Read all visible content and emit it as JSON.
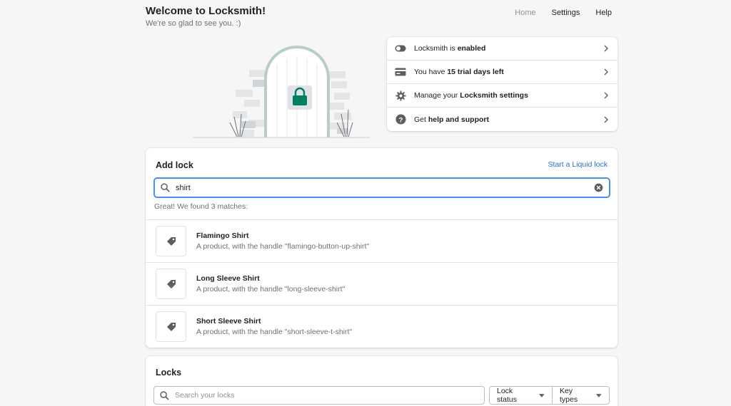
{
  "header": {
    "title": "Welcome to Locksmith!",
    "subtitle": "We're so glad to see you. :)",
    "nav": {
      "home": "Home",
      "settings": "Settings",
      "help": "Help"
    }
  },
  "status": {
    "items": [
      {
        "icon": "toggle-icon",
        "pre": "Locksmith is ",
        "bold": "enabled",
        "post": ""
      },
      {
        "icon": "credit-card-icon",
        "pre": "You have ",
        "bold": "15 trial days left",
        "post": ""
      },
      {
        "icon": "gear-icon",
        "pre": "Manage your ",
        "bold": "Locksmith settings",
        "post": ""
      },
      {
        "icon": "help-circle-icon",
        "pre": "Get ",
        "bold": "help and support",
        "post": ""
      }
    ]
  },
  "add_lock": {
    "title": "Add lock",
    "liquid_link": "Start a Liquid lock",
    "search_value": "shirt",
    "found_text": "Great! We found 3 matches:",
    "results": [
      {
        "name": "Flamingo Shirt",
        "desc": "A product, with the handle \"flamingo-button-up-shirt\""
      },
      {
        "name": "Long Sleeve Shirt",
        "desc": "A product, with the handle \"long-sleeve-shirt\""
      },
      {
        "name": "Short Sleeve Shirt",
        "desc": "A product, with the handle \"short-sleeve-t-shirt\""
      }
    ]
  },
  "locks": {
    "title": "Locks",
    "search_placeholder": "Search your locks",
    "filters": {
      "status": "Lock status",
      "keys": "Key types"
    }
  },
  "colors": {
    "accent": "#458fff",
    "link": "#2c6ecb",
    "lock_green": "#008060"
  }
}
